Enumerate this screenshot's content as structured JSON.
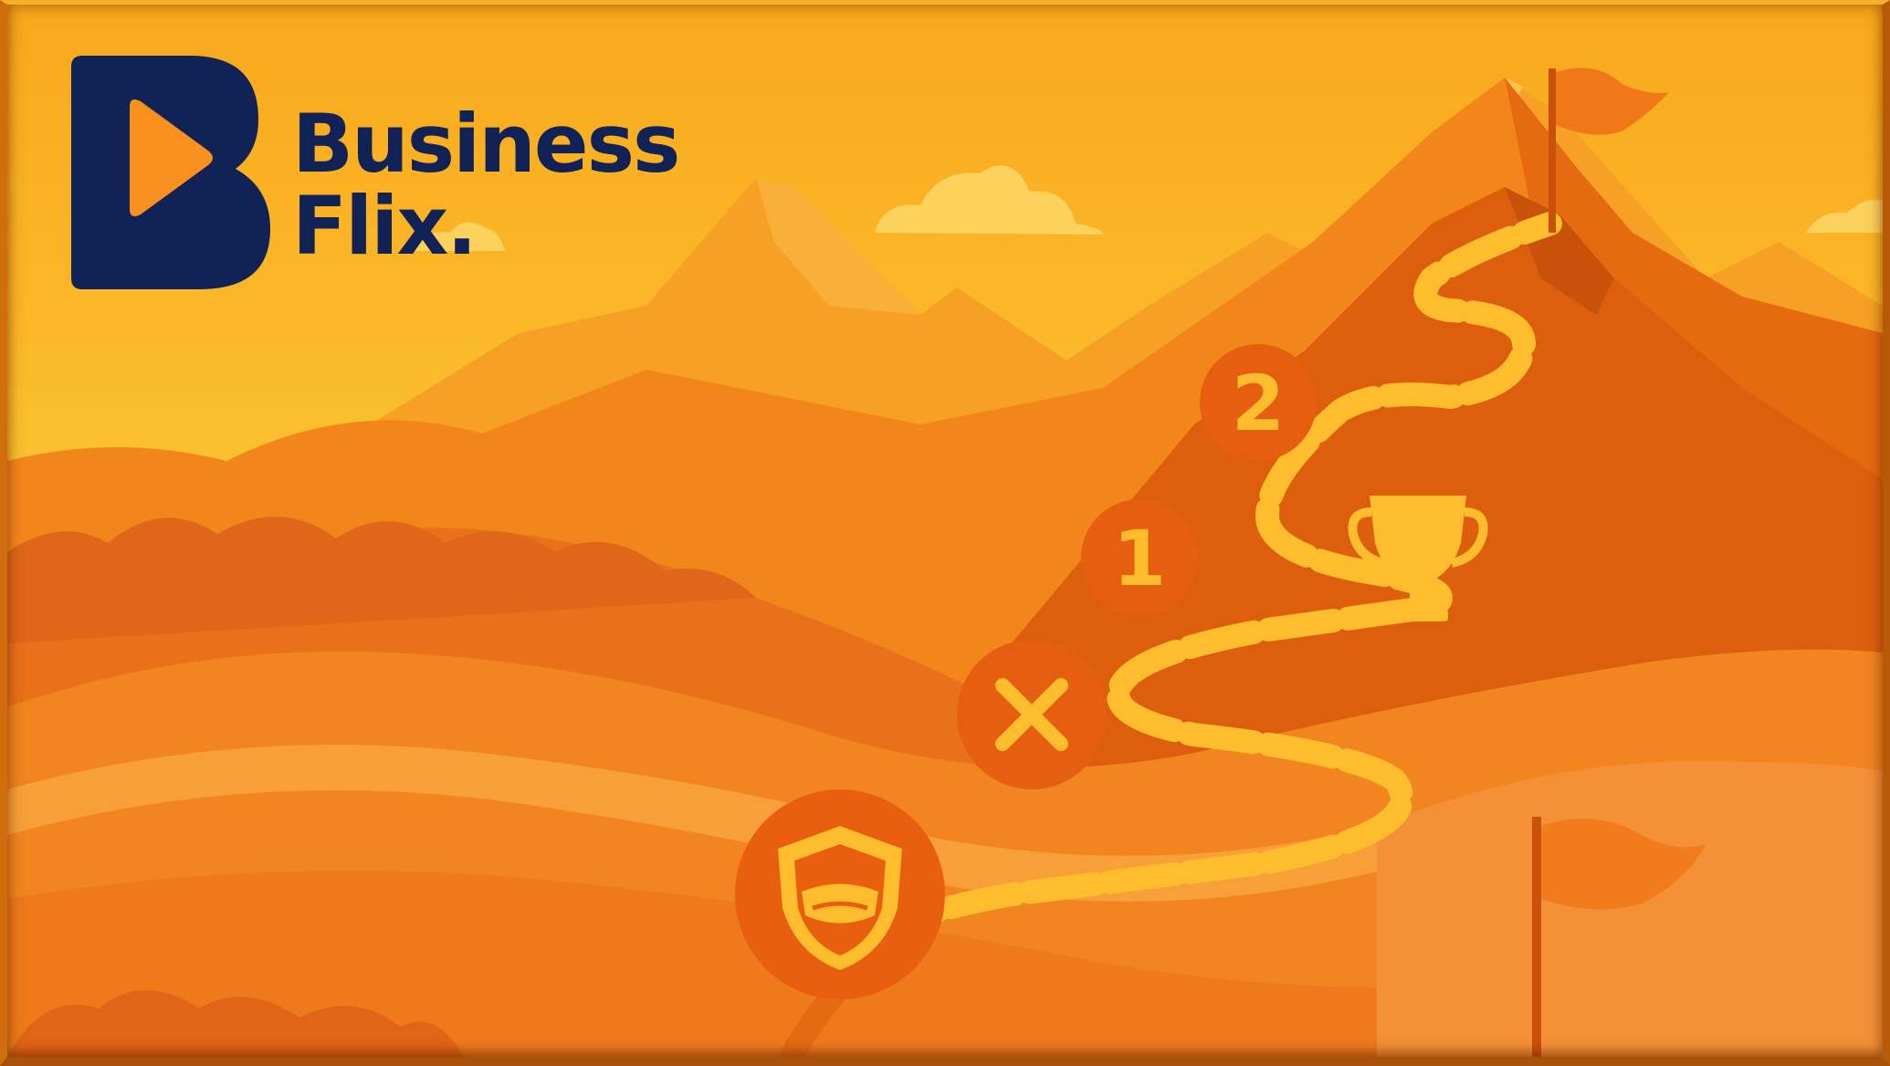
{
  "brand": {
    "line1": "Business",
    "line2": "Flix.",
    "navy": "#112256"
  },
  "markers": {
    "step1": "1",
    "step2": "2"
  },
  "icons": [
    "play-icon",
    "shield-mask-icon",
    "close-x-icon",
    "trophy-icon",
    "summit-flag-icon",
    "flag-icon"
  ],
  "colors": {
    "sky": "#fbc02d",
    "path": "#fdbd2c",
    "mountain_dark": "#d95a0a",
    "mountain_mid": "#f07a12",
    "mountain_light": "#f79a24"
  }
}
